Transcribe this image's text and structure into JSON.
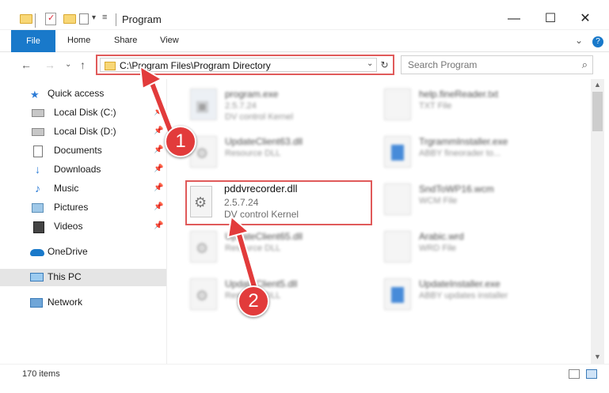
{
  "window": {
    "title": "Program",
    "minimize": "—",
    "maximize": "☐",
    "close": "✕"
  },
  "ribbon": {
    "tabs": [
      "File",
      "Home",
      "Share",
      "View"
    ],
    "expand": "⌄",
    "help": "?"
  },
  "nav": {
    "back": "←",
    "forward": "→",
    "recent": "⌄",
    "up": "↑",
    "address": "C:\\Program Files\\Program Directory",
    "address_dropdown": "⌄",
    "refresh": "↻",
    "search_placeholder": "Search Program",
    "search_icon": "⌕"
  },
  "sidebar": {
    "items": [
      {
        "label": "Quick access",
        "icon": "star-icon",
        "pinned": false
      },
      {
        "label": "Local Disk (C:)",
        "icon": "drive-icon",
        "pinned": true
      },
      {
        "label": "Local Disk (D:)",
        "icon": "drive-icon",
        "pinned": true
      },
      {
        "label": "Documents",
        "icon": "documents-icon",
        "pinned": true
      },
      {
        "label": "Downloads",
        "icon": "download-icon",
        "pinned": true
      },
      {
        "label": "Music",
        "icon": "music-icon",
        "pinned": true
      },
      {
        "label": "Pictures",
        "icon": "pictures-icon",
        "pinned": true
      },
      {
        "label": "Videos",
        "icon": "videos-icon",
        "pinned": true
      },
      {
        "label": "OneDrive",
        "icon": "cloud-icon",
        "pinned": false
      },
      {
        "label": "This PC",
        "icon": "computer-icon",
        "pinned": false
      },
      {
        "label": "Network",
        "icon": "network-icon",
        "pinned": false
      }
    ],
    "pin_glyph": "📌"
  },
  "files": [
    {
      "name": "program.exe",
      "version": "2.5.7.24",
      "description": "DV control Kernel",
      "type": "exe"
    },
    {
      "name": "help.fineReader.txt",
      "version": "TXT File",
      "description": "",
      "type": "txt"
    },
    {
      "name": "UpdateClient63.dll",
      "version": "Resource DLL",
      "description": "",
      "type": "dll"
    },
    {
      "name": "TrgrammInstaller.exe",
      "version": "ABBY fineorader to...",
      "description": "",
      "type": "blue"
    },
    {
      "name": "pddvrecorder.dll",
      "version": "2.5.7.24",
      "description": "DV control Kernel",
      "type": "dll"
    },
    {
      "name": "SndToWP16.wcm",
      "version": "WCM File",
      "description": "",
      "type": "txt"
    },
    {
      "name": "UpdateClient65.dll",
      "version": "Resource DLL",
      "description": "",
      "type": "dll"
    },
    {
      "name": "Arabic.wrd",
      "version": "WRD File",
      "description": "",
      "type": "txt"
    },
    {
      "name": "UpdateClient5.dll",
      "version": "Resource DLL",
      "description": "",
      "type": "dll"
    },
    {
      "name": "UpdateInstaller.exe",
      "version": "ABBY updates installer",
      "description": "",
      "type": "blue"
    }
  ],
  "status": {
    "item_count": "170 items"
  },
  "annotations": [
    {
      "number": "1"
    },
    {
      "number": "2"
    }
  ],
  "colors": {
    "accent": "#1979ca",
    "highlight": "#e05a5a",
    "badge": "#e23b3b"
  }
}
